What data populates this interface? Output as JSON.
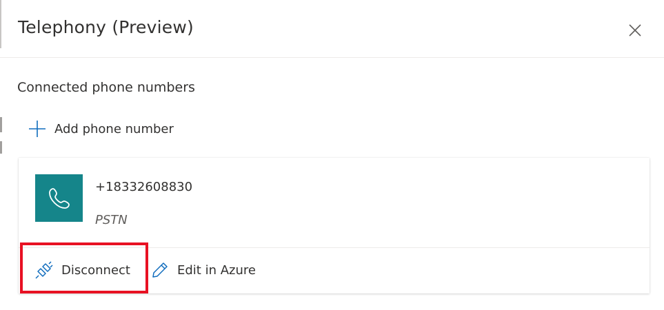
{
  "panel": {
    "title": "Telephony (Preview)",
    "close_icon": "close-icon"
  },
  "section": {
    "title": "Connected phone numbers",
    "add_label": "Add phone number",
    "add_icon": "plus-icon"
  },
  "phone_card": {
    "number": "+18332608830",
    "type": "PSTN",
    "icon": "phone-icon",
    "tile_color": "#15858a",
    "actions": [
      {
        "label": "Disconnect",
        "icon": "plug-disconnect-icon"
      },
      {
        "label": "Edit in Azure",
        "icon": "pencil-icon"
      }
    ]
  },
  "annotation": {
    "highlight_color": "#e81123",
    "highlight_target": "Disconnect"
  }
}
